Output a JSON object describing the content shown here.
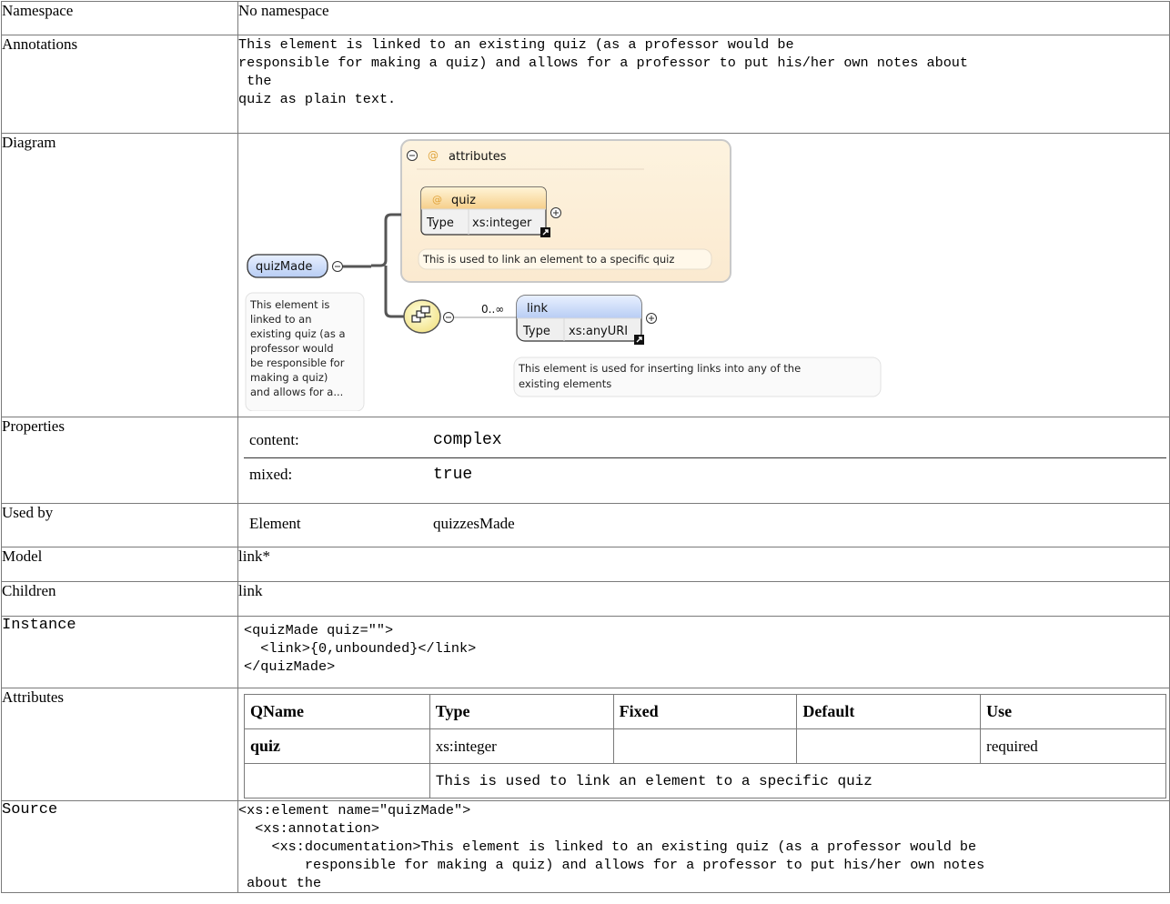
{
  "rows": {
    "namespace": {
      "label": "Namespace",
      "value": "No namespace"
    },
    "annotations": {
      "label": "Annotations",
      "lines": [
        "This element is linked to an existing quiz (as a professor would be",
        "responsible for making a quiz) and allows for a professor to put his/her own notes about",
        " the",
        "quiz as plain text."
      ]
    },
    "diagram": {
      "label": "Diagram",
      "attributes_group": "attributes",
      "attr_name": "quiz",
      "attr_type_label": "Type",
      "attr_type": "xs:integer",
      "attr_note": "This is used to link an element to a specific quiz",
      "element_name": "quizMade",
      "element_note": [
        "This element is",
        "linked to an",
        "existing quiz (as a",
        "professor would",
        "be responsible for",
        "making a quiz)",
        "and allows for a..."
      ],
      "cardinality": "0..∞",
      "child_name": "link",
      "child_type_label": "Type",
      "child_type": "xs:anyURI",
      "child_note": [
        "This element is used for inserting links into any of the",
        "existing elements"
      ]
    },
    "properties": {
      "label": "Properties",
      "items": [
        {
          "key": "content:",
          "value": "complex"
        },
        {
          "key": "mixed:",
          "value": "true"
        }
      ]
    },
    "used_by": {
      "label": "Used by",
      "kind": "Element",
      "value": "quizzesMade"
    },
    "model": {
      "label": "Model",
      "value": "link*"
    },
    "children": {
      "label": "Children",
      "value": "link"
    },
    "instance": {
      "label": "Instance",
      "lines": [
        "<quizMade quiz=\"\">",
        "  <link>{0,unbounded}</link>",
        "</quizMade>"
      ]
    },
    "attributes": {
      "label": "Attributes",
      "headers": [
        "QName",
        "Type",
        "Fixed",
        "Default",
        "Use"
      ],
      "rows": [
        {
          "qname": "quiz",
          "type": "xs:integer",
          "fixed": "",
          "default": "",
          "use": "required"
        }
      ],
      "note": "This is used to link an element to a specific quiz"
    },
    "source": {
      "label": "Source",
      "lines": [
        "<xs:element name=\"quizMade\">",
        "  <xs:annotation>",
        "    <xs:documentation>This element is linked to an existing quiz (as a professor would be",
        "        responsible for making a quiz) and allows for a professor to put his/her own notes",
        " about the"
      ]
    }
  }
}
